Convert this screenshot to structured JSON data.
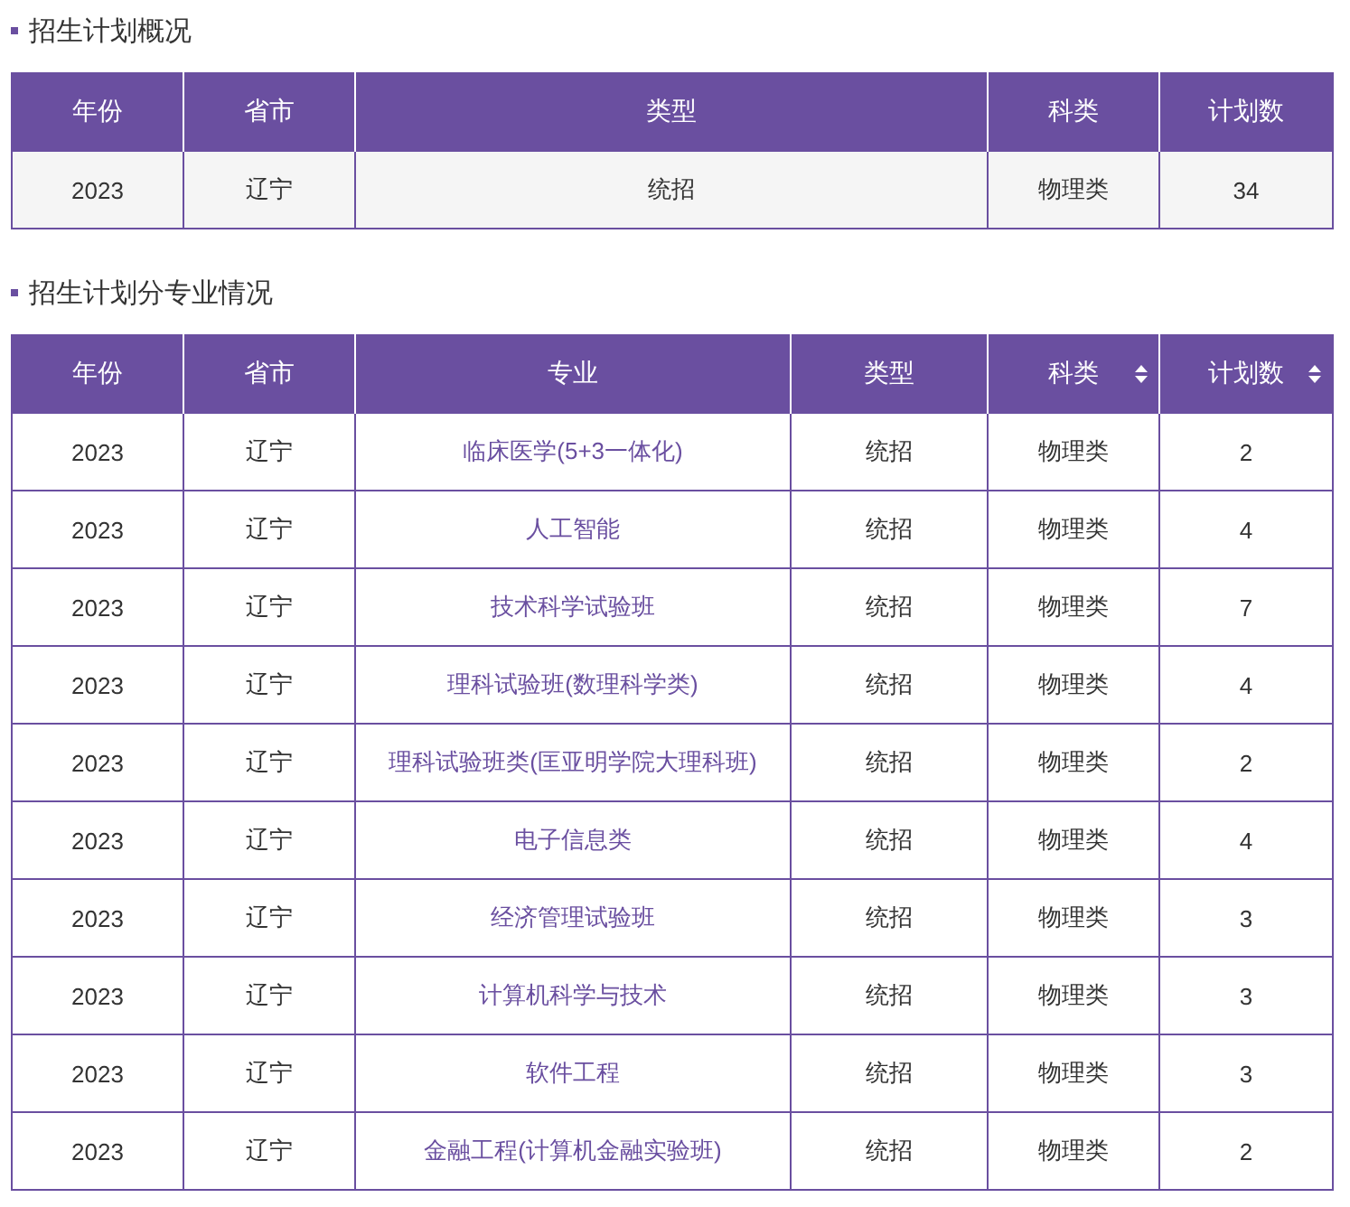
{
  "sections": [
    {
      "title": "招生计划概况",
      "table": {
        "columns": [
          {
            "label": "年份",
            "kind": "year",
            "sortable": false
          },
          {
            "label": "省市",
            "kind": "province",
            "sortable": false
          },
          {
            "label": "类型",
            "kind": "type",
            "sortable": false
          },
          {
            "label": "科类",
            "kind": "category",
            "sortable": false
          },
          {
            "label": "计划数",
            "kind": "plan",
            "sortable": false
          }
        ],
        "kind": "summary",
        "rows": [
          [
            "2023",
            "辽宁",
            "统招",
            "物理类",
            "34"
          ]
        ]
      }
    },
    {
      "title": "招生计划分专业情况",
      "table": {
        "columns": [
          {
            "label": "年份",
            "kind": "year",
            "sortable": false
          },
          {
            "label": "省市",
            "kind": "province",
            "sortable": false
          },
          {
            "label": "专业",
            "kind": "major",
            "sortable": false
          },
          {
            "label": "类型",
            "kind": "type",
            "sortable": false
          },
          {
            "label": "科类",
            "kind": "category",
            "sortable": true
          },
          {
            "label": "计划数",
            "kind": "plan",
            "sortable": true
          }
        ],
        "kind": "detail",
        "rows": [
          [
            "2023",
            "辽宁",
            "临床医学(5+3一体化)",
            "统招",
            "物理类",
            "2"
          ],
          [
            "2023",
            "辽宁",
            "人工智能",
            "统招",
            "物理类",
            "4"
          ],
          [
            "2023",
            "辽宁",
            "技术科学试验班",
            "统招",
            "物理类",
            "7"
          ],
          [
            "2023",
            "辽宁",
            "理科试验班(数理科学类)",
            "统招",
            "物理类",
            "4"
          ],
          [
            "2023",
            "辽宁",
            "理科试验班类(匡亚明学院大理科班)",
            "统招",
            "物理类",
            "2"
          ],
          [
            "2023",
            "辽宁",
            "电子信息类",
            "统招",
            "物理类",
            "4"
          ],
          [
            "2023",
            "辽宁",
            "经济管理试验班",
            "统招",
            "物理类",
            "3"
          ],
          [
            "2023",
            "辽宁",
            "计算机科学与技术",
            "统招",
            "物理类",
            "3"
          ],
          [
            "2023",
            "辽宁",
            "软件工程",
            "统招",
            "物理类",
            "3"
          ],
          [
            "2023",
            "辽宁",
            "金融工程(计算机金融实验班)",
            "统招",
            "物理类",
            "2"
          ]
        ]
      }
    }
  ]
}
